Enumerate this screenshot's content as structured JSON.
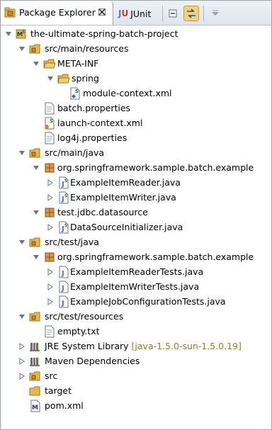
{
  "tabs": {
    "package_explorer": "Package Explorer",
    "junit": "JUnit"
  },
  "tree": {
    "project": "the-ultimate-spring-batch-project",
    "src_main_resources": "src/main/resources",
    "meta_inf": "META-INF",
    "spring": "spring",
    "module_context": "module-context.xml",
    "batch_properties": "batch.properties",
    "launch_context": "launch-context.xml",
    "log4j_properties": "log4j.properties",
    "src_main_java": "src/main/java",
    "pkg_example": "org.springframework.sample.batch.example",
    "reader": "ExampleItemReader.java",
    "writer": "ExampleItemWriter.java",
    "pkg_jdbc": "test.jdbc.datasource",
    "ds_init": "DataSourceInitializer.java",
    "src_test_java": "src/test/java",
    "pkg_example_test": "org.springframework.sample.batch.example",
    "reader_tests": "ExampleItemReaderTests.java",
    "writer_tests": "ExampleItemWriterTests.java",
    "job_config_tests": "ExampleJobConfigurationTests.java",
    "src_test_resources": "src/test/resources",
    "empty_txt": "empty.txt",
    "jre_library": "JRE System Library",
    "jre_version": "[java-1.5.0-sun-1.5.0.19]",
    "maven_deps": "Maven Dependencies",
    "src": "src",
    "target": "target",
    "pom": "pom.xml"
  },
  "colors": {
    "folder": "#e8b84a",
    "package": "#b8742a",
    "java": "#4a6fb5",
    "version_decoration": "#9a7a28"
  }
}
